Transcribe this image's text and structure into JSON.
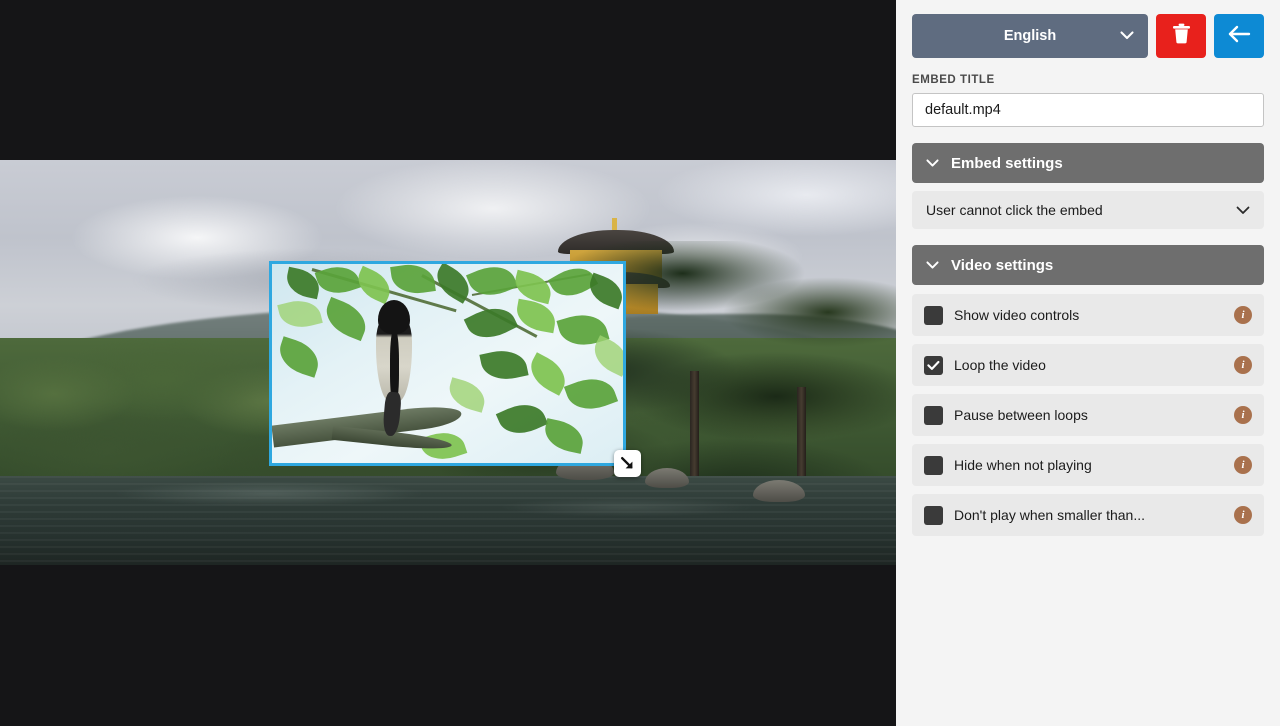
{
  "panel": {
    "language_selector": {
      "value": "English",
      "chevron_icon": "chevron-down-icon"
    },
    "delete_button": {
      "icon": "trash-icon",
      "color": "#e8211c"
    },
    "back_button": {
      "icon": "arrow-left-icon",
      "color": "#0d8ad4"
    },
    "embed_title": {
      "label": "EMBED TITLE",
      "value": "default.mp4",
      "placeholder": "default.mp4"
    },
    "embed_settings": {
      "header": "Embed settings",
      "chevron_icon": "chevron-down-icon",
      "click_behavior": {
        "value": "User cannot click the embed",
        "chevron_icon": "chevron-down-icon"
      }
    },
    "video_settings": {
      "header": "Video settings",
      "chevron_icon": "chevron-down-icon",
      "options": [
        {
          "label": "Show video controls",
          "checked": false,
          "info_icon": "info-icon"
        },
        {
          "label": "Loop the video",
          "checked": true,
          "info_icon": "info-icon"
        },
        {
          "label": "Pause between loops",
          "checked": false,
          "info_icon": "info-icon"
        },
        {
          "label": "Hide when not playing",
          "checked": false,
          "info_icon": "info-icon"
        },
        {
          "label": "Don't play when smaller than...",
          "checked": false,
          "info_icon": "info-icon"
        }
      ]
    }
  },
  "canvas": {
    "background_media": {
      "description": "Japanese garden landscape with golden pavilion, pine trees and lake"
    },
    "selected_embed": {
      "description": "Video embed showing a bird perched on a branch among green maple leaves",
      "selection_color": "#2fa8e0",
      "resize_handle_icon": "resize-arrow-icon"
    }
  },
  "colors": {
    "panel_background": "#f4f4f4",
    "section_header": "#6e6e6e",
    "row_background": "#e9e9e9",
    "language_button": "#5f6c80",
    "checkbox": "#3a3a3a",
    "info_badge": "#a9714d",
    "selection_border": "#2fa8e0"
  }
}
